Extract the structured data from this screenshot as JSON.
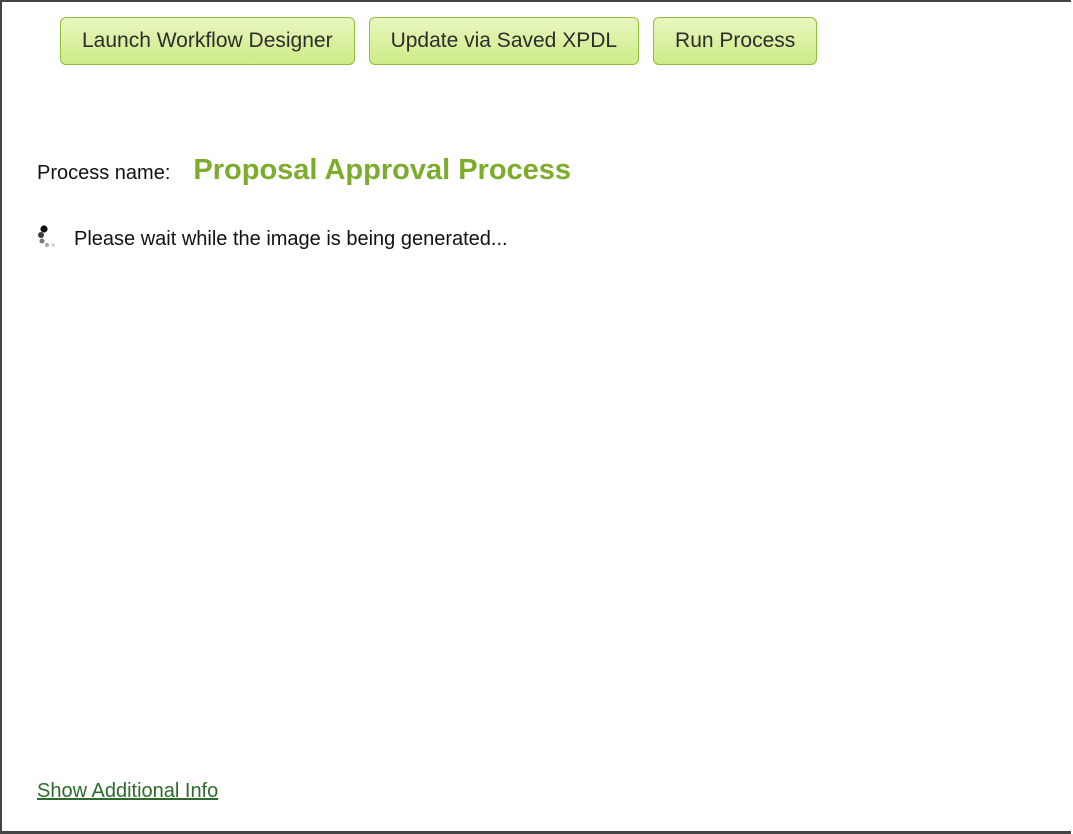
{
  "toolbar": {
    "launch_label": "Launch Workflow Designer",
    "update_label": "Update via Saved XPDL",
    "run_label": "Run Process"
  },
  "process": {
    "label": "Process name:",
    "name": "Proposal Approval Process"
  },
  "status": {
    "icon": "loading-spinner-icon",
    "message": "Please wait while the image is being generated..."
  },
  "footer": {
    "link_label": "Show Additional Info"
  },
  "colors": {
    "button_background": "#d6ef9c",
    "button_border": "#8fbf3a",
    "process_name": "#7bac2b",
    "link": "#2c6b2a"
  }
}
